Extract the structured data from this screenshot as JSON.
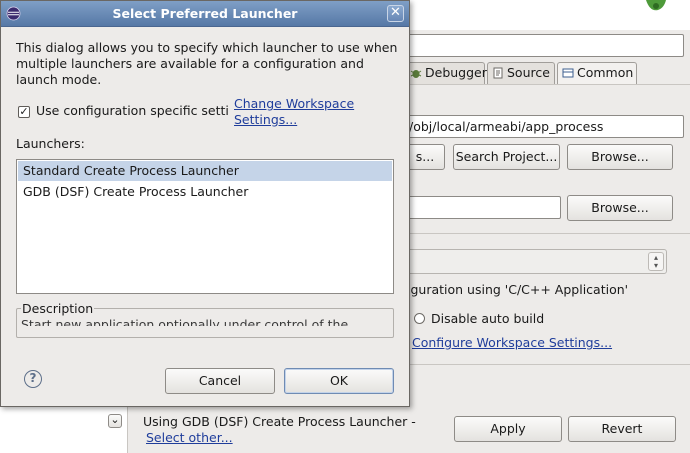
{
  "dialog": {
    "title": "Select Preferred Launcher",
    "description_line1": "This dialog allows you to specify which launcher to use when",
    "description_line2": "multiple launchers are available for a configuration and",
    "description_line3": "launch mode.",
    "use_config_checkbox_label": "Use configuration specific setti",
    "use_config_checked": true,
    "change_workspace_link_line1": "Change Workspace",
    "change_workspace_link_line2": "Settings...",
    "launchers_label": "Launchers:",
    "launchers": [
      {
        "label": "Standard Create Process Launcher",
        "selected": true
      },
      {
        "label": "GDB (DSF) Create Process Launcher",
        "selected": false
      }
    ],
    "description_group_label": "Description",
    "description_text": "Start new application optionally under control of the",
    "help_symbol": "?",
    "cancel_label": "Cancel",
    "ok_label": "OK",
    "close_symbol": "✕"
  },
  "background": {
    "tabs": [
      {
        "label": "Debugger",
        "icon": "debugger-icon"
      },
      {
        "label": "Source",
        "icon": "source-icon"
      },
      {
        "label": "Common",
        "icon": "common-icon"
      }
    ],
    "app_path_value": "/obj/local/armeabi/app_process",
    "browse_button_1_label": "s...",
    "search_project_label": "Search Project...",
    "browse_button_2_label": "Browse...",
    "browse_button_3_label": "Browse...",
    "config_text": "iguration using 'C/C++ Application'",
    "disable_auto_build_label": "Disable auto build",
    "configure_workspace_link": "Configure Workspace Settings...",
    "launcher_status": "Using GDB (DSF) Create Process Launcher -",
    "select_other_link": "Select other...",
    "apply_label": "Apply",
    "revert_label": "Revert",
    "scroll_down_symbol": "⌄"
  },
  "colors": {
    "titlebar": "#6689b8",
    "link": "#1f3d9b",
    "selection": "#c5d4e8",
    "dialog_bg": "#edebe9"
  }
}
